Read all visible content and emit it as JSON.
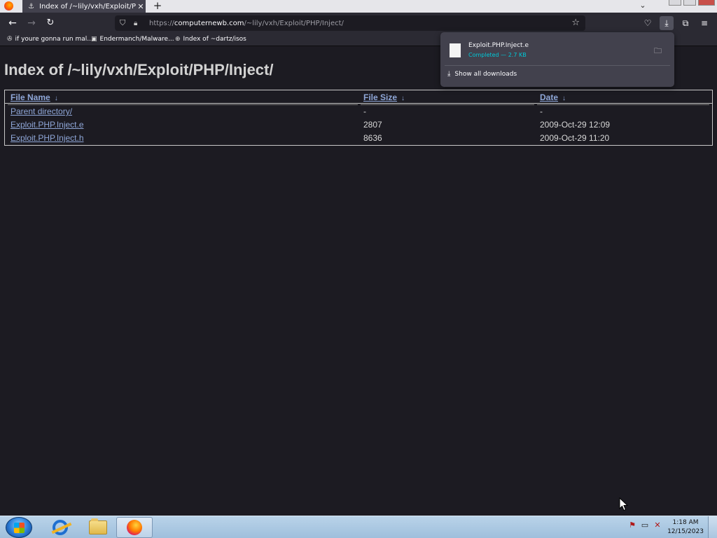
{
  "browser": {
    "active_tab_title": "Index of /~lily/vxh/Exploit/PHP/Inject/",
    "url_scheme": "https://",
    "url_host": "computernewb.com",
    "url_path": "/~lily/vxh/Exploit/PHP/Inject/",
    "bookmarks": [
      {
        "label": "if youre gonna run mal...",
        "icon": "bookmark-icon"
      },
      {
        "label": "Endermanch/Malware...",
        "icon": "github-icon"
      },
      {
        "label": "Index of ~dartz/isos",
        "icon": "globe-icon"
      }
    ]
  },
  "page": {
    "heading": "Index of /~lily/vxh/Exploit/PHP/Inject/",
    "columns": [
      {
        "label": "File Name",
        "sort_arrow": "↓"
      },
      {
        "label": "File Size",
        "sort_arrow": "↓"
      },
      {
        "label": "Date",
        "sort_arrow": "↓"
      }
    ],
    "rows": [
      {
        "name": "Parent directory/",
        "size": "-",
        "date": "-"
      },
      {
        "name": "Exploit.PHP.Inject.e",
        "size": "2807",
        "date": "2009-Oct-29 12:09"
      },
      {
        "name": "Exploit.PHP.Inject.h",
        "size": "8636",
        "date": "2009-Oct-29 11:20"
      }
    ]
  },
  "downloads_panel": {
    "file_name": "Exploit.PHP.Inject.e",
    "status": "Completed — 2.7 KB",
    "show_all_label": "Show all downloads"
  },
  "taskbar": {
    "time": "1:18 AM",
    "date": "12/15/2023"
  },
  "colors": {
    "page_background": "#1c1b22",
    "link": "#8fa7d8",
    "download_status": "#00c8d7"
  }
}
